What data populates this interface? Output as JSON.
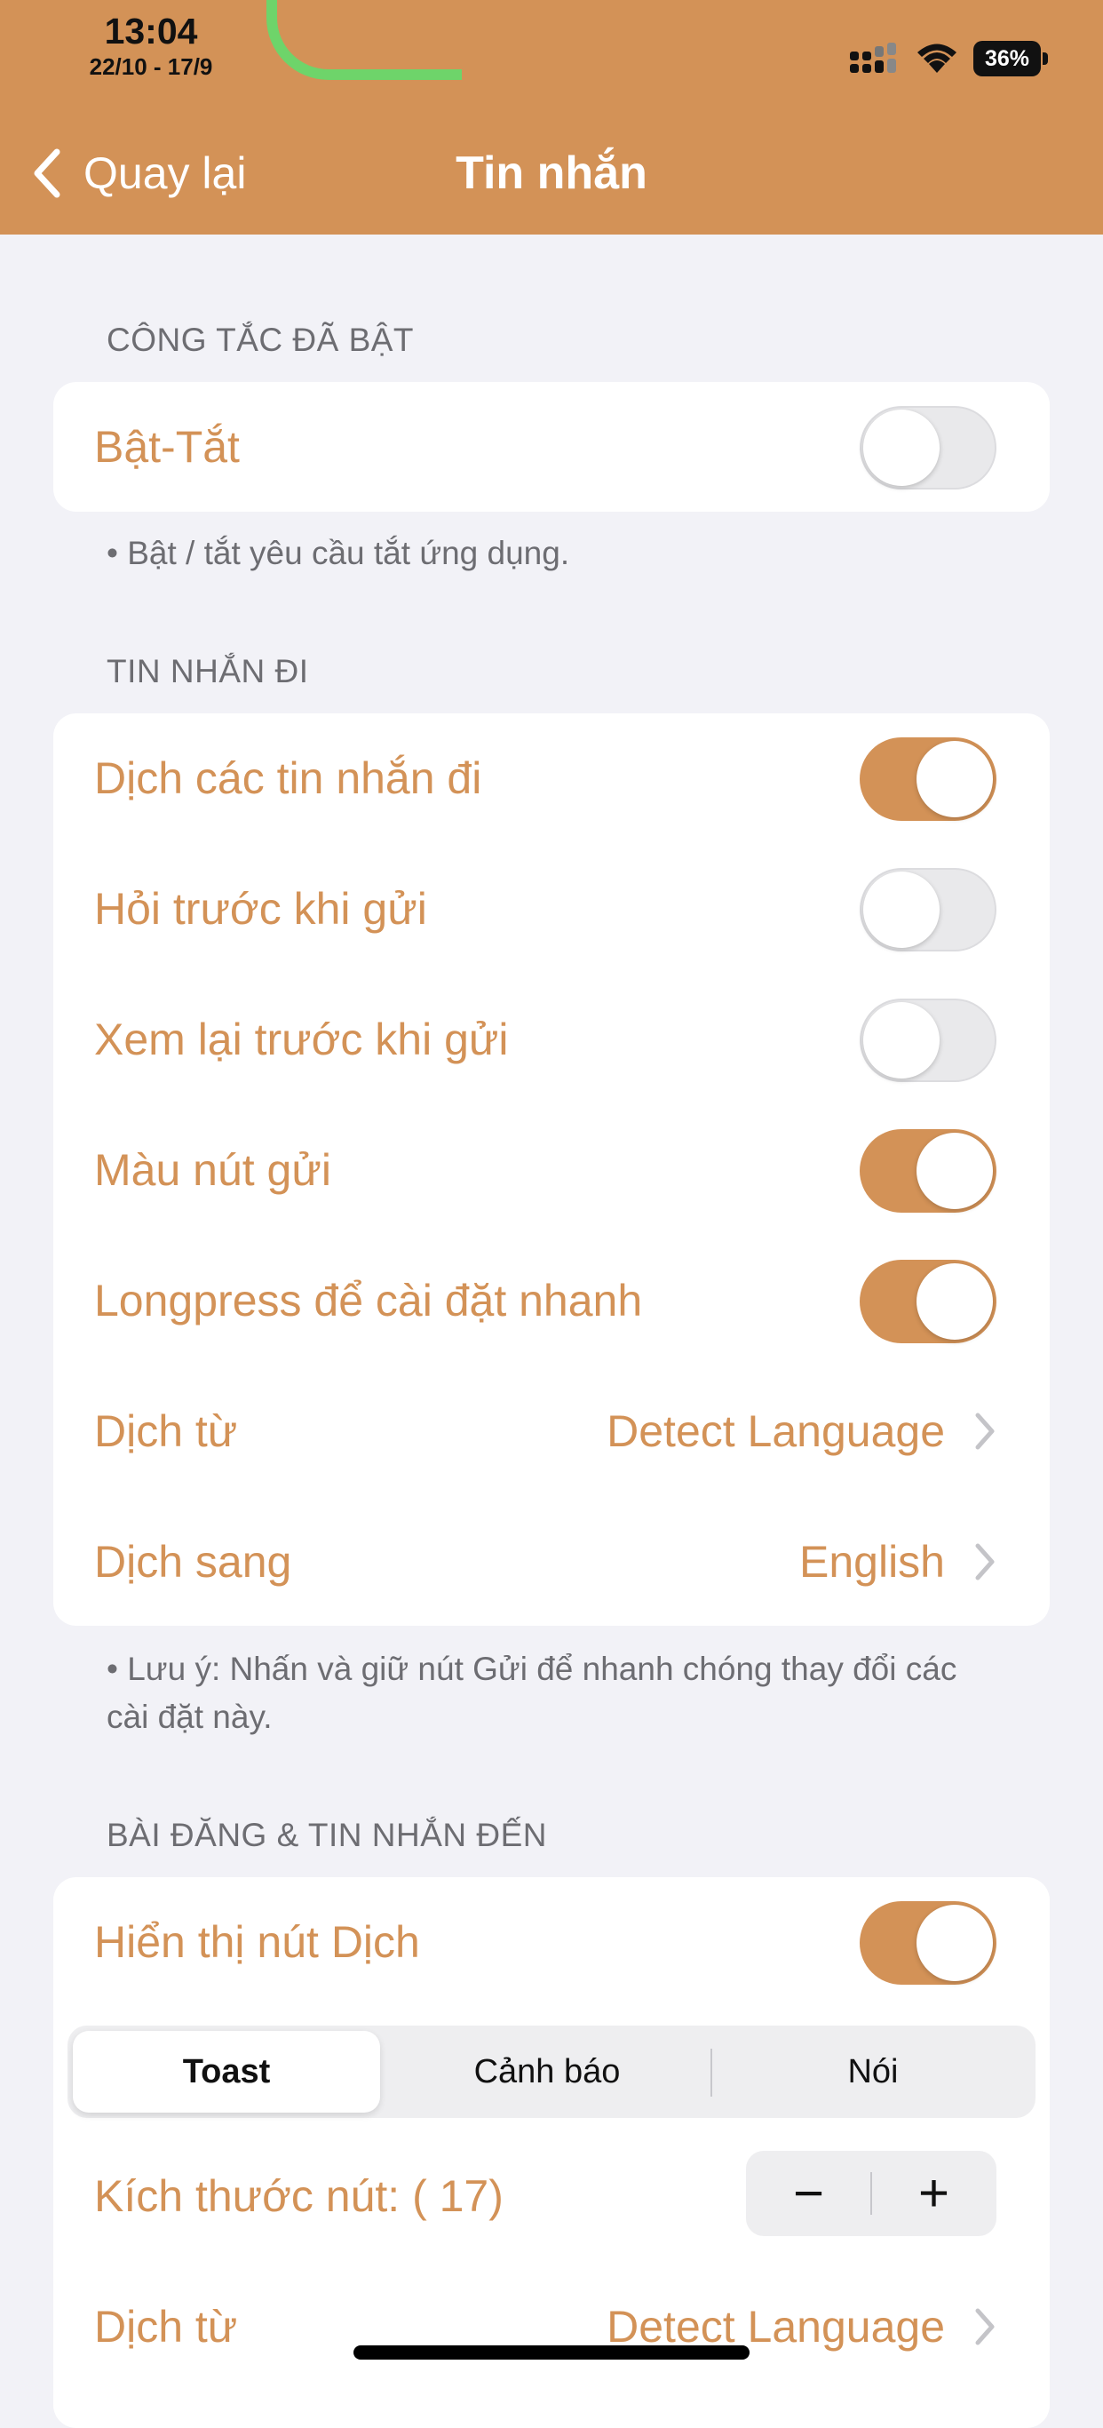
{
  "status_bar": {
    "time": "13:04",
    "date_range": "22/10 - 17/9",
    "battery": "36%"
  },
  "nav": {
    "back_label": "Quay lại",
    "title": "Tin nhắn"
  },
  "colors": {
    "accent": "#d39257",
    "background": "#f2f2f7",
    "card": "#ffffff",
    "secondary_text": "#6d6d72"
  },
  "section_switch": {
    "header": "CÔNG TẮC ĐÃ BẬT",
    "toggle_label": "Bật-Tắt",
    "toggle_on": false,
    "footer": "• Bật / tắt yêu cầu tắt ứng dụng."
  },
  "section_outgoing": {
    "header": "TIN NHẮN ĐI",
    "rows": [
      {
        "label": "Dịch các tin nhắn đi",
        "on": true
      },
      {
        "label": "Hỏi trước khi gửi",
        "on": false
      },
      {
        "label": "Xem lại trước khi gửi",
        "on": false
      },
      {
        "label": "Màu nút gửi",
        "on": true
      },
      {
        "label": "Longpress để cài đặt nhanh",
        "on": true
      }
    ],
    "translate_from_label": "Dịch từ",
    "translate_from_value": "Detect Language",
    "translate_to_label": "Dịch sang",
    "translate_to_value": "English",
    "footer": "• Lưu ý: Nhấn và giữ nút Gửi để nhanh chóng thay đổi các cài đặt này."
  },
  "section_incoming": {
    "header": "BÀI ĐĂNG & TIN NHẮN ĐẾN",
    "show_button_label": "Hiển thị nút Dịch",
    "show_button_on": true,
    "segments": [
      "Toast",
      "Cảnh báo",
      "Nói"
    ],
    "selected_segment": "Toast",
    "size_label": "Kích thước nút: ( 17)",
    "size_value": 17,
    "stepper_minus": "−",
    "stepper_plus": "+",
    "translate_from_label": "Dịch từ",
    "translate_from_value": "Detect Language"
  }
}
